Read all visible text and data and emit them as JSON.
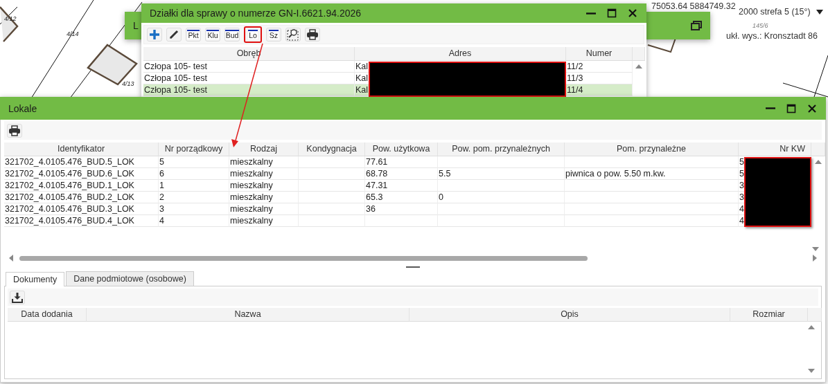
{
  "map": {
    "parcel_labels": [
      "4/12",
      "4/14",
      "4/13",
      "145/6"
    ],
    "coordinates": "75053.64 5884749.32",
    "crs": "2000 strefa 5 (15°)",
    "height_system": "ukł. wys.: Kronsztadt 86"
  },
  "back_window": {
    "title": "L"
  },
  "parcels_window": {
    "title": "Działki dla sprawy o numerze GN-I.6621.94.2026",
    "toolbar": [
      {
        "kind": "add",
        "highlighted": false
      },
      {
        "kind": "edit",
        "highlighted": false
      },
      {
        "kind": "label",
        "label": "Pkt",
        "highlighted": false
      },
      {
        "kind": "label",
        "label": "Klu",
        "highlighted": false
      },
      {
        "kind": "label",
        "label": "Bud",
        "highlighted": false
      },
      {
        "kind": "label",
        "label": "Lo",
        "highlighted": true
      },
      {
        "kind": "label",
        "label": "Sz",
        "highlighted": false
      },
      {
        "kind": "zoom",
        "highlighted": false
      },
      {
        "kind": "print",
        "highlighted": false
      }
    ],
    "columns": [
      "Obręb",
      "Adres",
      "Numer"
    ],
    "rows": [
      {
        "cells": [
          "Człopa 105- test",
          "Kal",
          "11/2"
        ],
        "selected": false
      },
      {
        "cells": [
          "Człopa 105- test",
          "Kal",
          "11/3"
        ],
        "selected": false
      },
      {
        "cells": [
          "Człopa 105- test",
          "Kal",
          "11/4"
        ],
        "selected": true
      }
    ]
  },
  "lokale_window": {
    "title": "Lokale",
    "columns": [
      "Identyfikator",
      "Nr porządkowy",
      "Rodzaj",
      "Kondygnacja",
      "Pow. użytkowa",
      "Pow. pom. przynależnych",
      "Pom. przynależne",
      "Nr KW"
    ],
    "rows": [
      [
        "321702_4.0105.476_BUD.5_LOK",
        "5",
        "mieszkalny",
        "",
        "77.61",
        "",
        "",
        "5"
      ],
      [
        "321702_4.0105.476_BUD.6_LOK",
        "6",
        "mieszkalny",
        "",
        "68.78",
        "5.5",
        "piwnica o pow. 5.50 m.kw.",
        "5"
      ],
      [
        "321702_4.0105.476_BUD.1_LOK",
        "1",
        "mieszkalny",
        "",
        "47.31",
        "",
        "",
        "3"
      ],
      [
        "321702_4.0105.476_BUD.2_LOK",
        "2",
        "mieszkalny",
        "",
        "65.3",
        "0",
        "",
        "3"
      ],
      [
        "321702_4.0105.476_BUD.3_LOK",
        "3",
        "mieszkalny",
        "",
        "36",
        "",
        "",
        "4"
      ],
      [
        "321702_4.0105.476_BUD.4_LOK",
        "4",
        "mieszkalny",
        "",
        "",
        "",
        "",
        "4"
      ]
    ],
    "tabs": [
      {
        "label": "Dokumenty",
        "selected": true
      },
      {
        "label": "Dane podmiotowe (osobowe)",
        "selected": false
      }
    ],
    "documents": {
      "columns": [
        "Data dodania",
        "Nazwa",
        "Opis",
        "Rozmiar"
      ]
    }
  }
}
